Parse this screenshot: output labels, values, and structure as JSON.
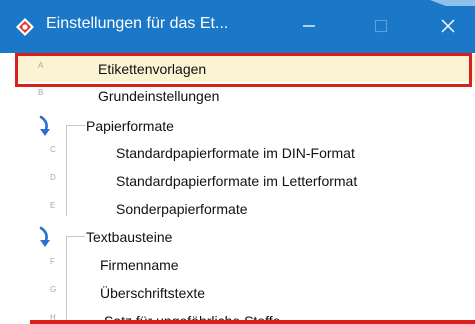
{
  "window": {
    "title": "Einstellungen für das Et...",
    "icon": "diamond-app-icon",
    "controls": [
      "minimize-icon",
      "maximize-icon",
      "close-icon"
    ],
    "titlebar_color": "#1b78c8"
  },
  "list": {
    "items": [
      {
        "key": "A",
        "label": "Etikettenvorlagen"
      },
      {
        "key": "B",
        "label": "Grundeinstellungen"
      },
      {
        "key": "",
        "label": "Papierformate"
      },
      {
        "key": "C",
        "label": "Standardpapierformate im DIN-Format"
      },
      {
        "key": "D",
        "label": "Standardpapierformate im Letterformat"
      },
      {
        "key": "E",
        "label": "Sonderpapierformate"
      },
      {
        "key": "",
        "label": "Textbausteine"
      },
      {
        "key": "F",
        "label": "Firmenname"
      },
      {
        "key": "G",
        "label": "Überschriftstexte"
      },
      {
        "key": "H",
        "label": "Satz für ungefährliche Stoffe"
      }
    ],
    "selected_color": "#fbf3d2",
    "highlight_color": "#d9201c"
  }
}
